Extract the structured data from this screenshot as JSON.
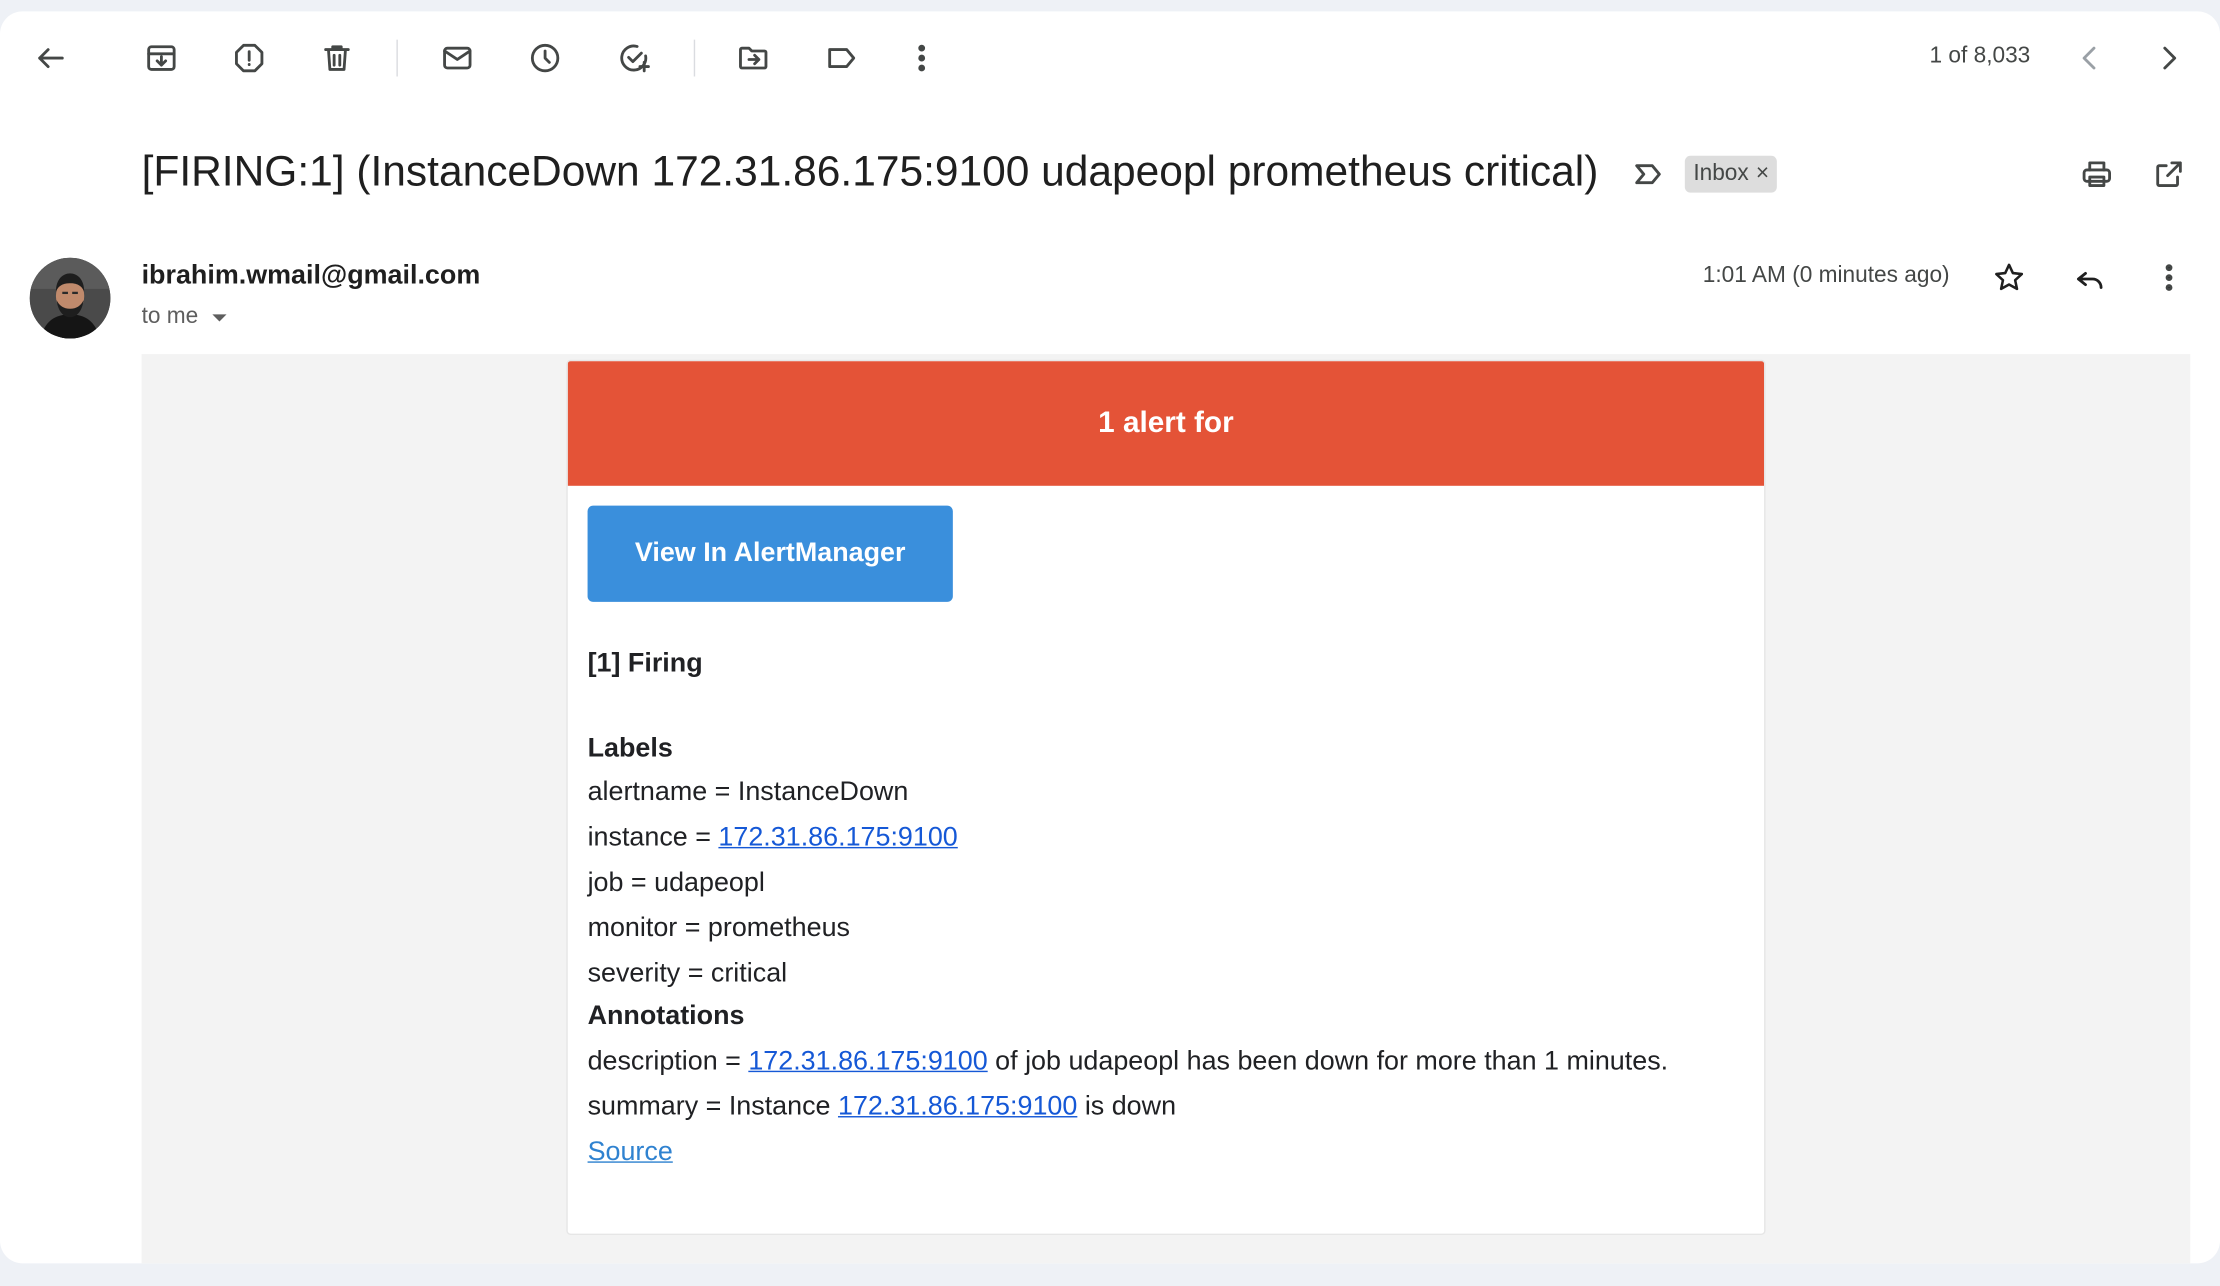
{
  "toolbar": {
    "icons": [
      "back-arrow-icon",
      "archive-icon",
      "report-spam-icon",
      "delete-icon",
      "mark-unread-icon",
      "snooze-icon",
      "add-to-tasks-icon",
      "move-to-icon",
      "label-icon",
      "more-vert-icon"
    ],
    "pager_text": "1 of 8,033"
  },
  "email": {
    "subject": "[FIRING:1] (InstanceDown 172.31.86.175:9100 udapeopl prometheus critical)",
    "label_chip": "Inbox",
    "label_chip_remove": "×",
    "sender": "ibrahim.wmail@gmail.com",
    "recipients": "to me",
    "time": "1:01 AM (0 minutes ago)"
  },
  "alert": {
    "header": "1 alert for",
    "header_color": "#e45337",
    "button_label": "View In AlertManager",
    "button_color": "#3a8fdc",
    "firing": "[1] Firing",
    "labels_title": "Labels",
    "alertname_line": "alertname = InstanceDown",
    "instance_prefix": "instance = ",
    "instance_link": "172.31.86.175:9100",
    "job_line": "job = udapeopl",
    "monitor_line": "monitor = prometheus",
    "severity_line": "severity = critical",
    "annotations_title": "Annotations",
    "description_prefix": "description = ",
    "description_link": "172.31.86.175:9100",
    "description_suffix": " of job udapeopl has been down for more than 1 minutes.",
    "summary_prefix": "summary = Instance ",
    "summary_link": "172.31.86.175:9100",
    "summary_suffix": " is down",
    "source_link": "Source"
  }
}
